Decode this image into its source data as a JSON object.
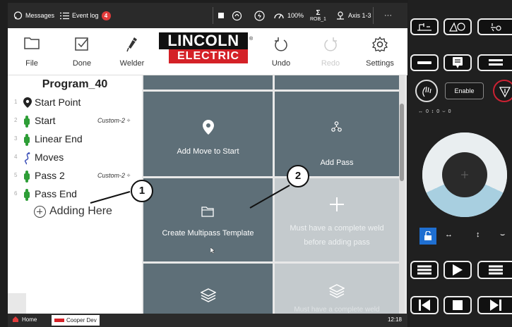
{
  "statusbar": {
    "messages_label": "Messages",
    "event_log_label": "Event log",
    "event_log_count": "4",
    "speed": "100%",
    "robot": "ROB_1",
    "axis": "Axis 1-3",
    "more": "···"
  },
  "toolbar": {
    "file": "File",
    "done": "Done",
    "welder": "Welder",
    "logo_top": "LINCOLN",
    "logo_bottom": "ELECTRIC",
    "logo_reg": "®",
    "undo": "Undo",
    "redo": "Redo",
    "settings": "Settings"
  },
  "program": {
    "title": "Program_40",
    "steps": [
      {
        "num": "1",
        "name": "Start Point",
        "tag": ""
      },
      {
        "num": "2",
        "name": "Start",
        "tag": "Custom-2 ÷"
      },
      {
        "num": "3",
        "name": "Linear End",
        "tag": ""
      },
      {
        "num": "4",
        "name": "Moves",
        "tag": ""
      },
      {
        "num": "5",
        "name": "Pass 2",
        "tag": "Custom-2 ÷"
      },
      {
        "num": "6",
        "name": "Pass End",
        "tag": ""
      }
    ],
    "adding_here": "Adding Here"
  },
  "tiles": {
    "add_move_to_start": "Add Move to Start",
    "add_pass": "Add Pass",
    "create_multipass_template": "Create Multipass Template",
    "must_have_weld": "Must have a complete weld before adding pass",
    "bottom_faded_text": "Must have a complete weld"
  },
  "callouts": {
    "one": "1",
    "two": "2"
  },
  "taskbar": {
    "home": "Home",
    "app": "Cooper Dev",
    "time": "12:18"
  },
  "pendant": {
    "enable": "Enable",
    "axis_readout": "↔ 0 ↕ 0 ⌣ 0"
  }
}
